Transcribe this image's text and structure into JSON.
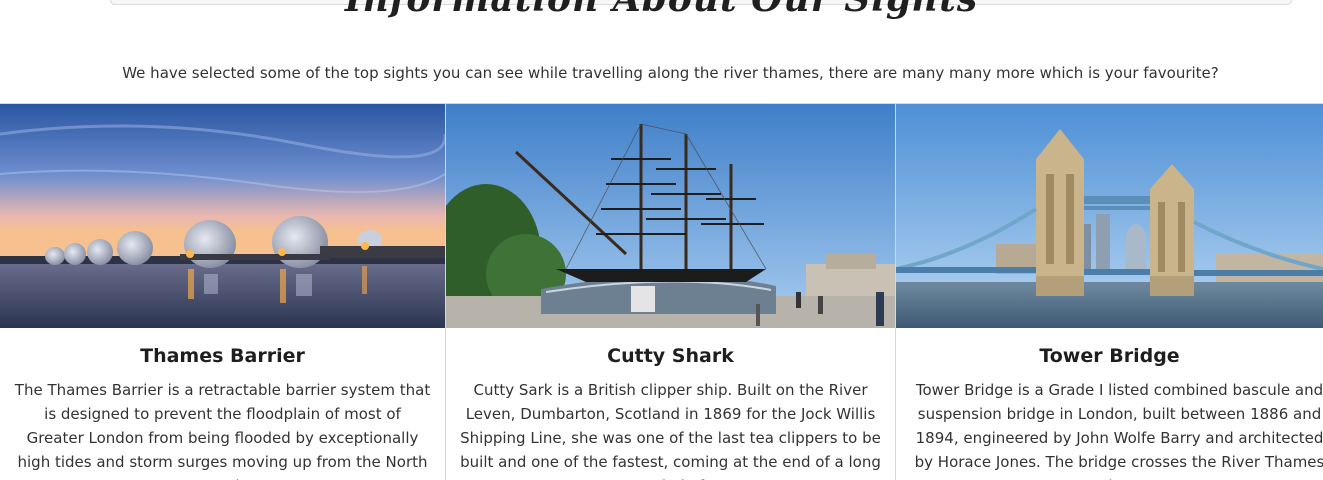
{
  "page": {
    "heading": "Information About Our Sights",
    "subtitle": "We have selected some of the top sights you can see while travelling along the river thames, there are many many more which is your favourite?"
  },
  "sights": [
    {
      "title": "Thames Barrier",
      "image_alt": "Thames Barrier at sunset",
      "description": "The Thames Barrier is a retractable barrier system that is designed to prevent the floodplain of most of Greater London from being flooded by exceptionally high tides and storm surges moving up from the North Sea. It has"
    },
    {
      "title": "Cutty Shark",
      "image_alt": "Cutty Sark clipper ship",
      "description": "Cutty Sark is a British clipper ship. Built on the River Leven, Dumbarton, Scotland in 1869 for the Jock Willis Shipping Line, she was one of the last tea clippers to be built and one of the fastest, coming at the end of a long period of"
    },
    {
      "title": "Tower Bridge",
      "image_alt": "Tower Bridge in London",
      "description": "Tower Bridge is a Grade I listed combined bascule and suspension bridge in London, built between 1886 and 1894, engineered by John Wolfe Barry and architected by Horace Jones. The bridge crosses the River Thames close"
    }
  ],
  "colors": {
    "sky_dusk_top": "#2f5fa8",
    "sky_dusk_bottom": "#f3b9a0",
    "sky_day": "#5f97d4",
    "water": "#4b6d8c"
  }
}
